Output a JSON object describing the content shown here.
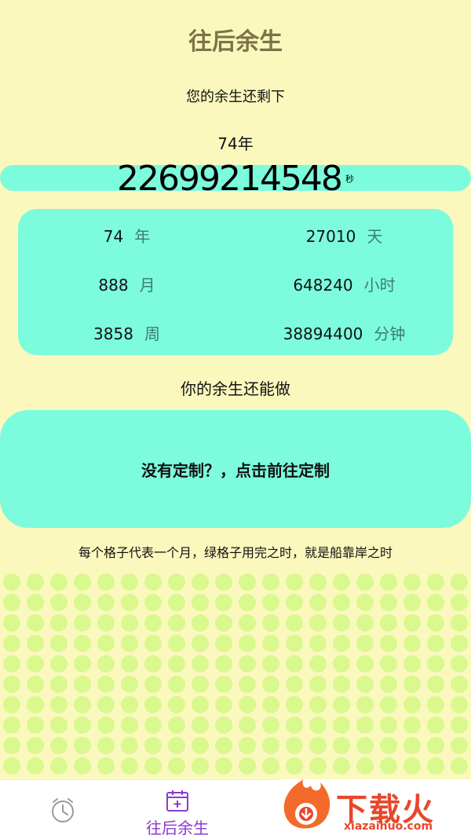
{
  "header": {
    "title": "往后余生"
  },
  "summary": {
    "subtitle": "您的余生还剩下",
    "years_text": "74年",
    "seconds": "22699214548",
    "seconds_unit": "秒"
  },
  "stats": [
    {
      "value": "74",
      "unit": "年"
    },
    {
      "value": "27010",
      "unit": "天"
    },
    {
      "value": "888",
      "unit": "月"
    },
    {
      "value": "648240",
      "unit": "小时"
    },
    {
      "value": "3858",
      "unit": "周"
    },
    {
      "value": "38894400",
      "unit": "分钟"
    }
  ],
  "plans": {
    "heading": "你的余生还能做",
    "empty_prompt": "没有定制？，点击前往定制"
  },
  "grid": {
    "description": "每个格子代表一个月，绿格子用完之时，就是船靠岸之时",
    "dot_color": "#D9F88E"
  },
  "tabbar": {
    "active_label": "往后余生",
    "active_color": "#8A3BD0",
    "timer_icon": "alarm-clock-icon",
    "calendar_icon": "calendar-add-icon"
  },
  "watermark": {
    "brand": "下载火",
    "url": "xiazaihuo.com"
  },
  "colors": {
    "background": "#FBF8BE",
    "accent": "#7CFCDC",
    "title": "#7B7448"
  }
}
